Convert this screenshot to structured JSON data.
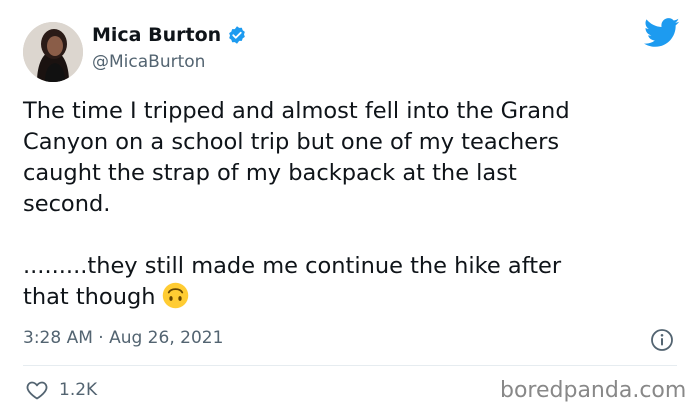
{
  "user": {
    "display_name": "Mica Burton",
    "handle": "@MicaBurton",
    "verified": true
  },
  "tweet": {
    "paragraph_1": "The time I tripped and almost fell into the Grand\nCanyon on a school trip but one of my teachers\ncaught the strap of my backpack at the last\nsecond.",
    "paragraph_2": ".........they still made me continue the hike after\nthat though",
    "emoji": "upside-down-face-emoji"
  },
  "meta": {
    "timestamp": "3:28 AM · Aug 26, 2021"
  },
  "stats": {
    "likes": "1.2K"
  },
  "watermark": "boredpanda.com",
  "colors": {
    "twitter_blue": "#1d9bf0",
    "text": "#0f1419",
    "muted": "#536471",
    "emoji_yellow": "#ffcc33"
  },
  "icons": {
    "brand": "twitter-bird-icon",
    "verified": "verified-badge-icon",
    "info": "info-icon",
    "like": "heart-icon"
  }
}
